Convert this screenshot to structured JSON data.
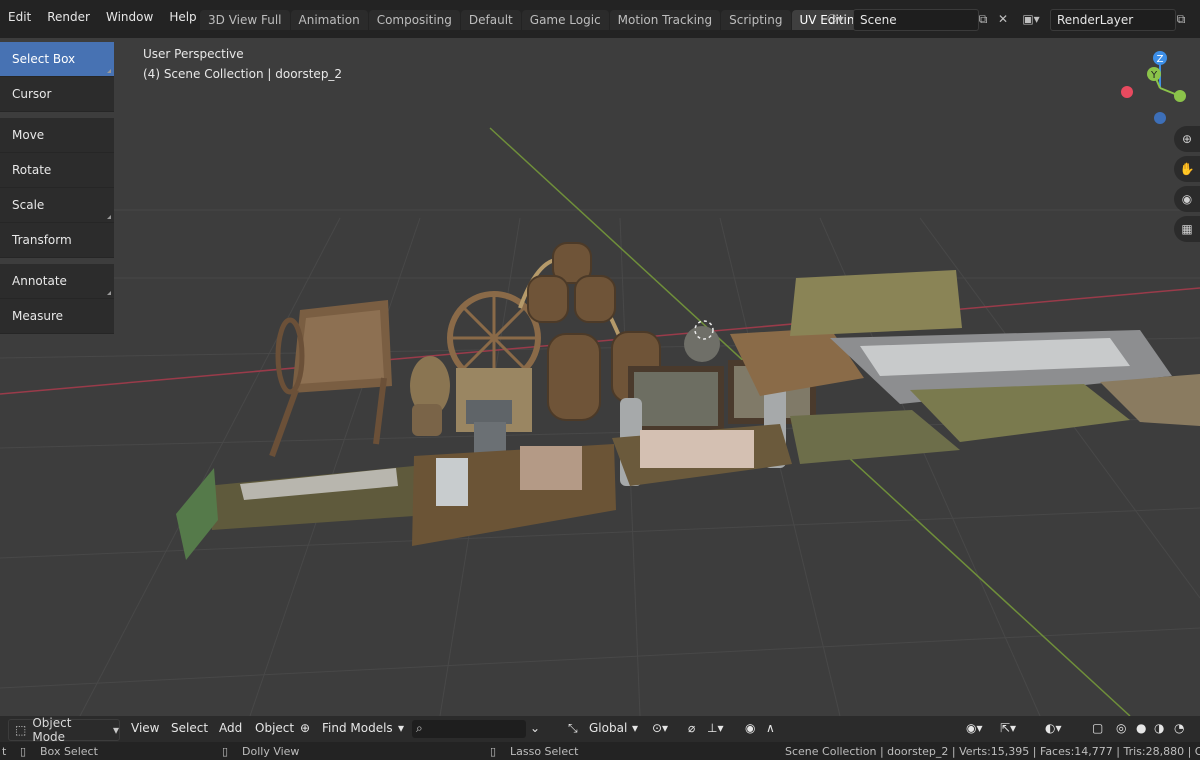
{
  "menu": [
    "Edit",
    "Render",
    "Window",
    "Help"
  ],
  "workspaces": [
    "3D View Full",
    "Animation",
    "Compositing",
    "Default",
    "Game Logic",
    "Motion Tracking",
    "Scripting",
    "UV Editin"
  ],
  "active_workspace": "UV Editin",
  "scene": "Scene",
  "render_layer": "RenderLayer",
  "tools": [
    "Select Box",
    "Cursor",
    "Move",
    "Rotate",
    "Scale",
    "Transform",
    "Annotate",
    "Measure"
  ],
  "viewport": {
    "perspective": "User Perspective",
    "collection": "(4) Scene Collection | doorstep_2"
  },
  "gizmo_axes": {
    "z": "Z",
    "y": "Y"
  },
  "header": {
    "mode": "Object Mode",
    "view": "View",
    "select": "Select",
    "add": "Add",
    "object": "Object",
    "find_models": "Find Models",
    "transform_orientation": "Global"
  },
  "status": {
    "left_partial": "t",
    "box_select": "Box Select",
    "dolly_view": "Dolly View",
    "lasso_select": "Lasso Select",
    "stats": "Scene Collection | doorstep_2 | Verts:15,395 | Faces:14,777 | Tris:28,880 | Ob"
  },
  "colors": {
    "active": "#4772b3",
    "axis_x": "#e84a5f",
    "axis_y": "#8bc34a",
    "axis_z": "#3d8fe8"
  }
}
